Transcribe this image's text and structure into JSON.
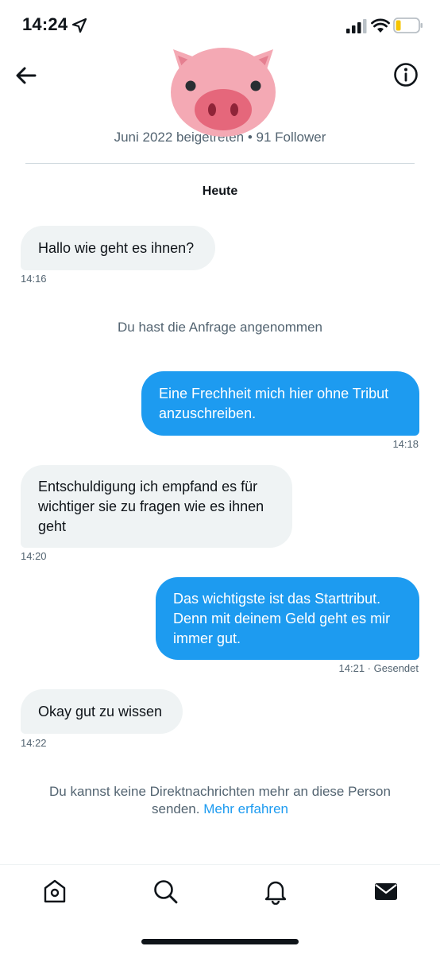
{
  "status_bar": {
    "time": "14:24"
  },
  "header": {
    "profile_meta": "Juni 2022 beigetreten • 91 Follower"
  },
  "conversation": {
    "date_label": "Heute",
    "messages": [
      {
        "direction": "in",
        "text": "Hallo wie geht es ihnen?",
        "time": "14:16"
      },
      {
        "direction": "out",
        "text": "Eine Frechheit mich hier ohne Tribut anzuschreiben.",
        "time": "14:18"
      },
      {
        "direction": "in",
        "text": "Entschuldigung ich empfand es für wichtiger sie zu fragen wie es ihnen geht",
        "time": "14:20"
      },
      {
        "direction": "out",
        "text": "Das wichtigste ist das Starttribut. Denn mit deinem Geld geht es mir immer gut.",
        "time": "14:21 · Gesendet"
      },
      {
        "direction": "in",
        "text": "Okay gut zu wissen",
        "time": "14:22"
      }
    ],
    "request_accepted_note": "Du hast die Anfrage angenommen",
    "blocked_note": "Du kannst keine Direktnachrichten mehr an diese Person senden.",
    "learn_more_link": "Mehr erfahren"
  },
  "bottom_nav": {
    "items": [
      {
        "icon": "home-icon"
      },
      {
        "icon": "search-icon"
      },
      {
        "icon": "bell-icon"
      },
      {
        "icon": "mail-icon",
        "active": true
      }
    ]
  },
  "colors": {
    "accent": "#1d9bf0",
    "incoming_bubble": "#eff3f4",
    "muted_text": "#536471"
  }
}
